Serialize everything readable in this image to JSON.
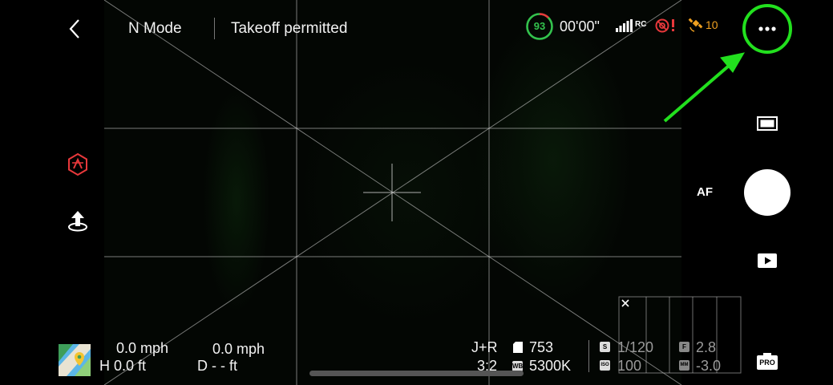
{
  "top_bar": {
    "flight_mode": "N Mode",
    "status": "Takeoff permitted",
    "battery_percent": "93",
    "flight_time": "00'00\"",
    "rc_label": "RC",
    "satellite_count": "10"
  },
  "camera": {
    "af_label": "AF"
  },
  "telemetry": {
    "horizontal_speed": "0.0 mph",
    "vertical_speed": "0.0 mph",
    "height": "H 0.0 ft",
    "distance": "D - - ft"
  },
  "camera_info": {
    "format": "J+R",
    "remaining_photos": "753",
    "aspect_ratio": "3:2",
    "white_balance": "5300K",
    "shutter_speed": "1/120",
    "iso": "100",
    "aperture": "2.8",
    "exposure_value": "-3.0",
    "badge_s": "S",
    "badge_iso": "ISO",
    "badge_f": "F",
    "badge_mm": "MM",
    "badge_wb": "WB",
    "pro_label": "PRO"
  },
  "colors": {
    "battery_ring": "#33c24d",
    "warning_red": "#e8383b",
    "satellite_orange": "#f0a020",
    "annotation_green": "#22e01e"
  }
}
